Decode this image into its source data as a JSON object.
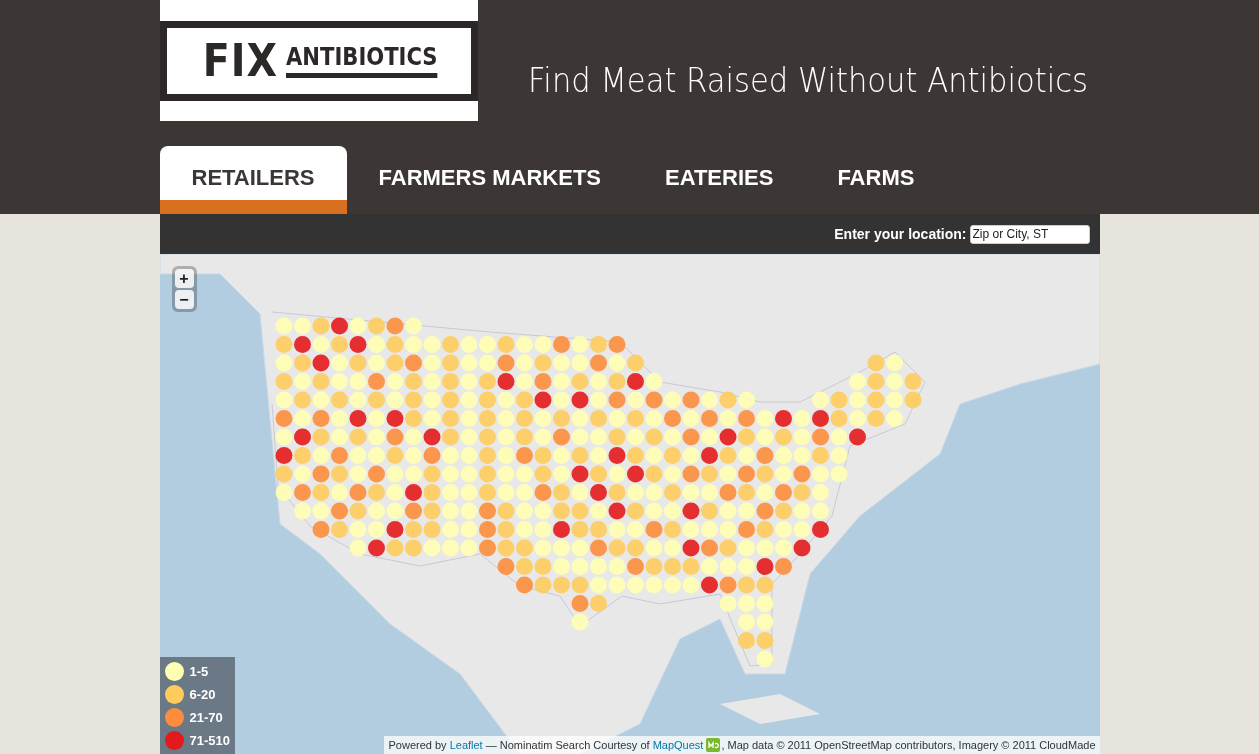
{
  "logo": {
    "word_1": "FIX",
    "word_2": "ANTIBIOTICS"
  },
  "title": "Find Meat Raised Without Antibiotics",
  "tabs": [
    {
      "label": "RETAILERS",
      "selected": true
    },
    {
      "label": "FARMERS MARKETS",
      "selected": false
    },
    {
      "label": "EATERIES",
      "selected": false
    },
    {
      "label": "FARMS",
      "selected": false
    }
  ],
  "location": {
    "label": "Enter your location:",
    "placeholder": "Zip or City, ST"
  },
  "zoom_controls": [
    "+",
    "−"
  ],
  "legend": [
    {
      "label": "1-5",
      "color": "#ffffb2"
    },
    {
      "label": "6-20",
      "color": "#fecc5c"
    },
    {
      "label": "21-70",
      "color": "#fd8d3c"
    },
    {
      "label": "71-510",
      "color": "#e31a1c"
    }
  ],
  "attribution": [
    {
      "kind": "text",
      "text": "Powered by "
    },
    {
      "kind": "link",
      "text": "Leaflet"
    },
    {
      "kind": "text",
      "text": " — Nominatim Search Courtesy of "
    },
    {
      "kind": "link",
      "text": "MapQuest"
    },
    {
      "kind": "logo"
    },
    {
      "kind": "text",
      "text": ", Map data © 2011 OpenStreetMap contributors, Imagery © 2011 CloudMade"
    }
  ]
}
